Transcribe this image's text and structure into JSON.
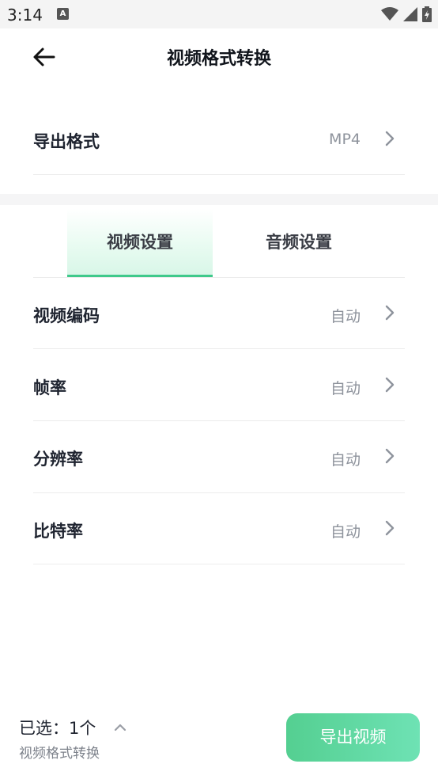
{
  "status_bar": {
    "time": "3:14",
    "notification_letter": "A"
  },
  "header": {
    "title": "视频格式转换"
  },
  "export_format": {
    "label": "导出格式",
    "value": "MP4"
  },
  "tabs": [
    {
      "label": "视频设置",
      "active": true
    },
    {
      "label": "音频设置",
      "active": false
    }
  ],
  "settings": [
    {
      "label": "视频编码",
      "value": "自动"
    },
    {
      "label": "帧率",
      "value": "自动"
    },
    {
      "label": "分辨率",
      "value": "自动"
    },
    {
      "label": "比特率",
      "value": "自动"
    }
  ],
  "footer": {
    "selected_text": "已选：1个",
    "subtitle": "视频格式转换",
    "export_button": "导出视频"
  },
  "colors": {
    "accent": "#3fc98b",
    "button_start": "#54cf91",
    "button_end": "#6ee2b4"
  }
}
